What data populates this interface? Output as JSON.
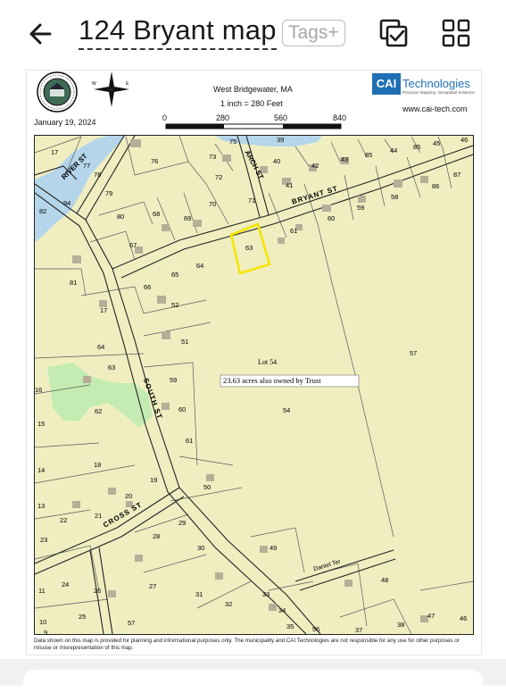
{
  "header": {
    "title": "124 Bryant map",
    "tags_label": "Tags+",
    "icons": {
      "back": "back-arrow-icon",
      "copy": "copy-check-icon",
      "grid": "grid-icon"
    }
  },
  "sheet": {
    "location": "West Bridgewater, MA",
    "scale": "1 inch = 280 Feet",
    "date": "January 19, 2024",
    "scale_ticks": [
      "0",
      "280",
      "560",
      "840"
    ],
    "brand": "CAI",
    "brand_name": "Technologies",
    "brand_tagline": "Precision Mapping. Geospatial Solutions",
    "website": "www.cai-tech.com",
    "disclaimer": "Data shown on this map is provided for planning and informational purposes only. The municipality and CAI Technologies are not responsible for any use for other purposes or misuse or misrepresentation of this map."
  },
  "map": {
    "streets": [
      "RIVER ST",
      "ARCH ST",
      "BRYANT ST",
      "SOUTH ST",
      "CROSS ST",
      "Daniel Ter"
    ],
    "annotation_lot": "Lot 54",
    "annotation_note": "23.63 acres also owned by Trust",
    "highlighted_parcel": "63",
    "parcels": [
      "17",
      "77",
      "78",
      "76",
      "73",
      "75",
      "39",
      "40",
      "42",
      "43",
      "85",
      "44",
      "85",
      "45",
      "46",
      "94",
      "79",
      "72",
      "41",
      "87",
      "82",
      "80",
      "68",
      "69",
      "70",
      "71",
      "58",
      "86",
      "60",
      "59",
      "67",
      "61",
      "63",
      "81",
      "66",
      "65",
      "64",
      "17",
      "52",
      "51",
      "64",
      "57",
      "63",
      "59",
      "16",
      "62",
      "60",
      "54",
      "15",
      "61",
      "14",
      "18",
      "50",
      "19",
      "13",
      "20",
      "22",
      "21",
      "28",
      "29",
      "23",
      "30",
      "49",
      "48",
      "11",
      "24",
      "26",
      "27",
      "31",
      "33",
      "32",
      "34",
      "10",
      "9",
      "25",
      "57",
      "35",
      "56",
      "37",
      "38",
      "47",
      "46"
    ],
    "colors": {
      "land": "#f0eec1",
      "water": "#b5d6ea",
      "wetland": "#c4ecb2",
      "highlight": "#f5e600",
      "line": "#1c1c1c"
    }
  }
}
